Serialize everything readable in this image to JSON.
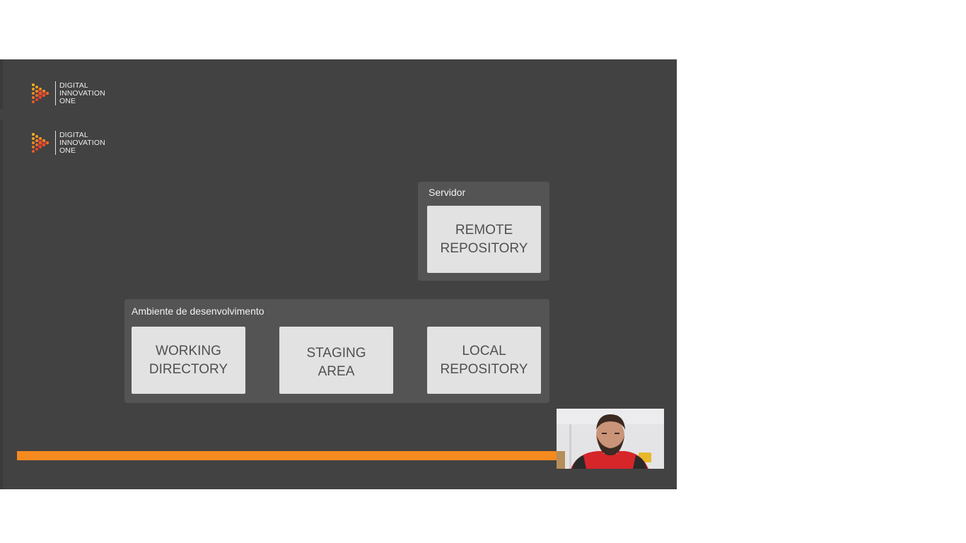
{
  "logos": [
    {
      "lines": [
        "DIGITAL",
        "INNOVATION",
        "ONE"
      ]
    },
    {
      "lines": [
        "DIGITAL",
        "INNOVATION",
        "ONE"
      ]
    }
  ],
  "diagram": {
    "server_group": {
      "label": "Servidor",
      "boxes": [
        {
          "line1": "REMOTE",
          "line2": "REPOSITORY"
        }
      ]
    },
    "dev_group": {
      "label": "Ambiente de desenvolvimento",
      "boxes": [
        {
          "line1": "WORKING",
          "line2": "DIRECTORY"
        },
        {
          "line1": "STAGING",
          "line2": "AREA"
        },
        {
          "line1": "LOCAL",
          "line2": "REPOSITORY"
        }
      ]
    }
  },
  "progress": {
    "fraction": 1.0
  },
  "colors": {
    "slide_background": "#424242",
    "group_background": "#545454",
    "box_background": "#e2e2e2",
    "accent_orange": "#f58a1f",
    "logo_mark": [
      "#f9a21b",
      "#e8422f"
    ]
  },
  "icons": {
    "logo_mark": "digital-innovation-one-logo-icon",
    "webcam": "presenter-webcam-thumbnail"
  }
}
